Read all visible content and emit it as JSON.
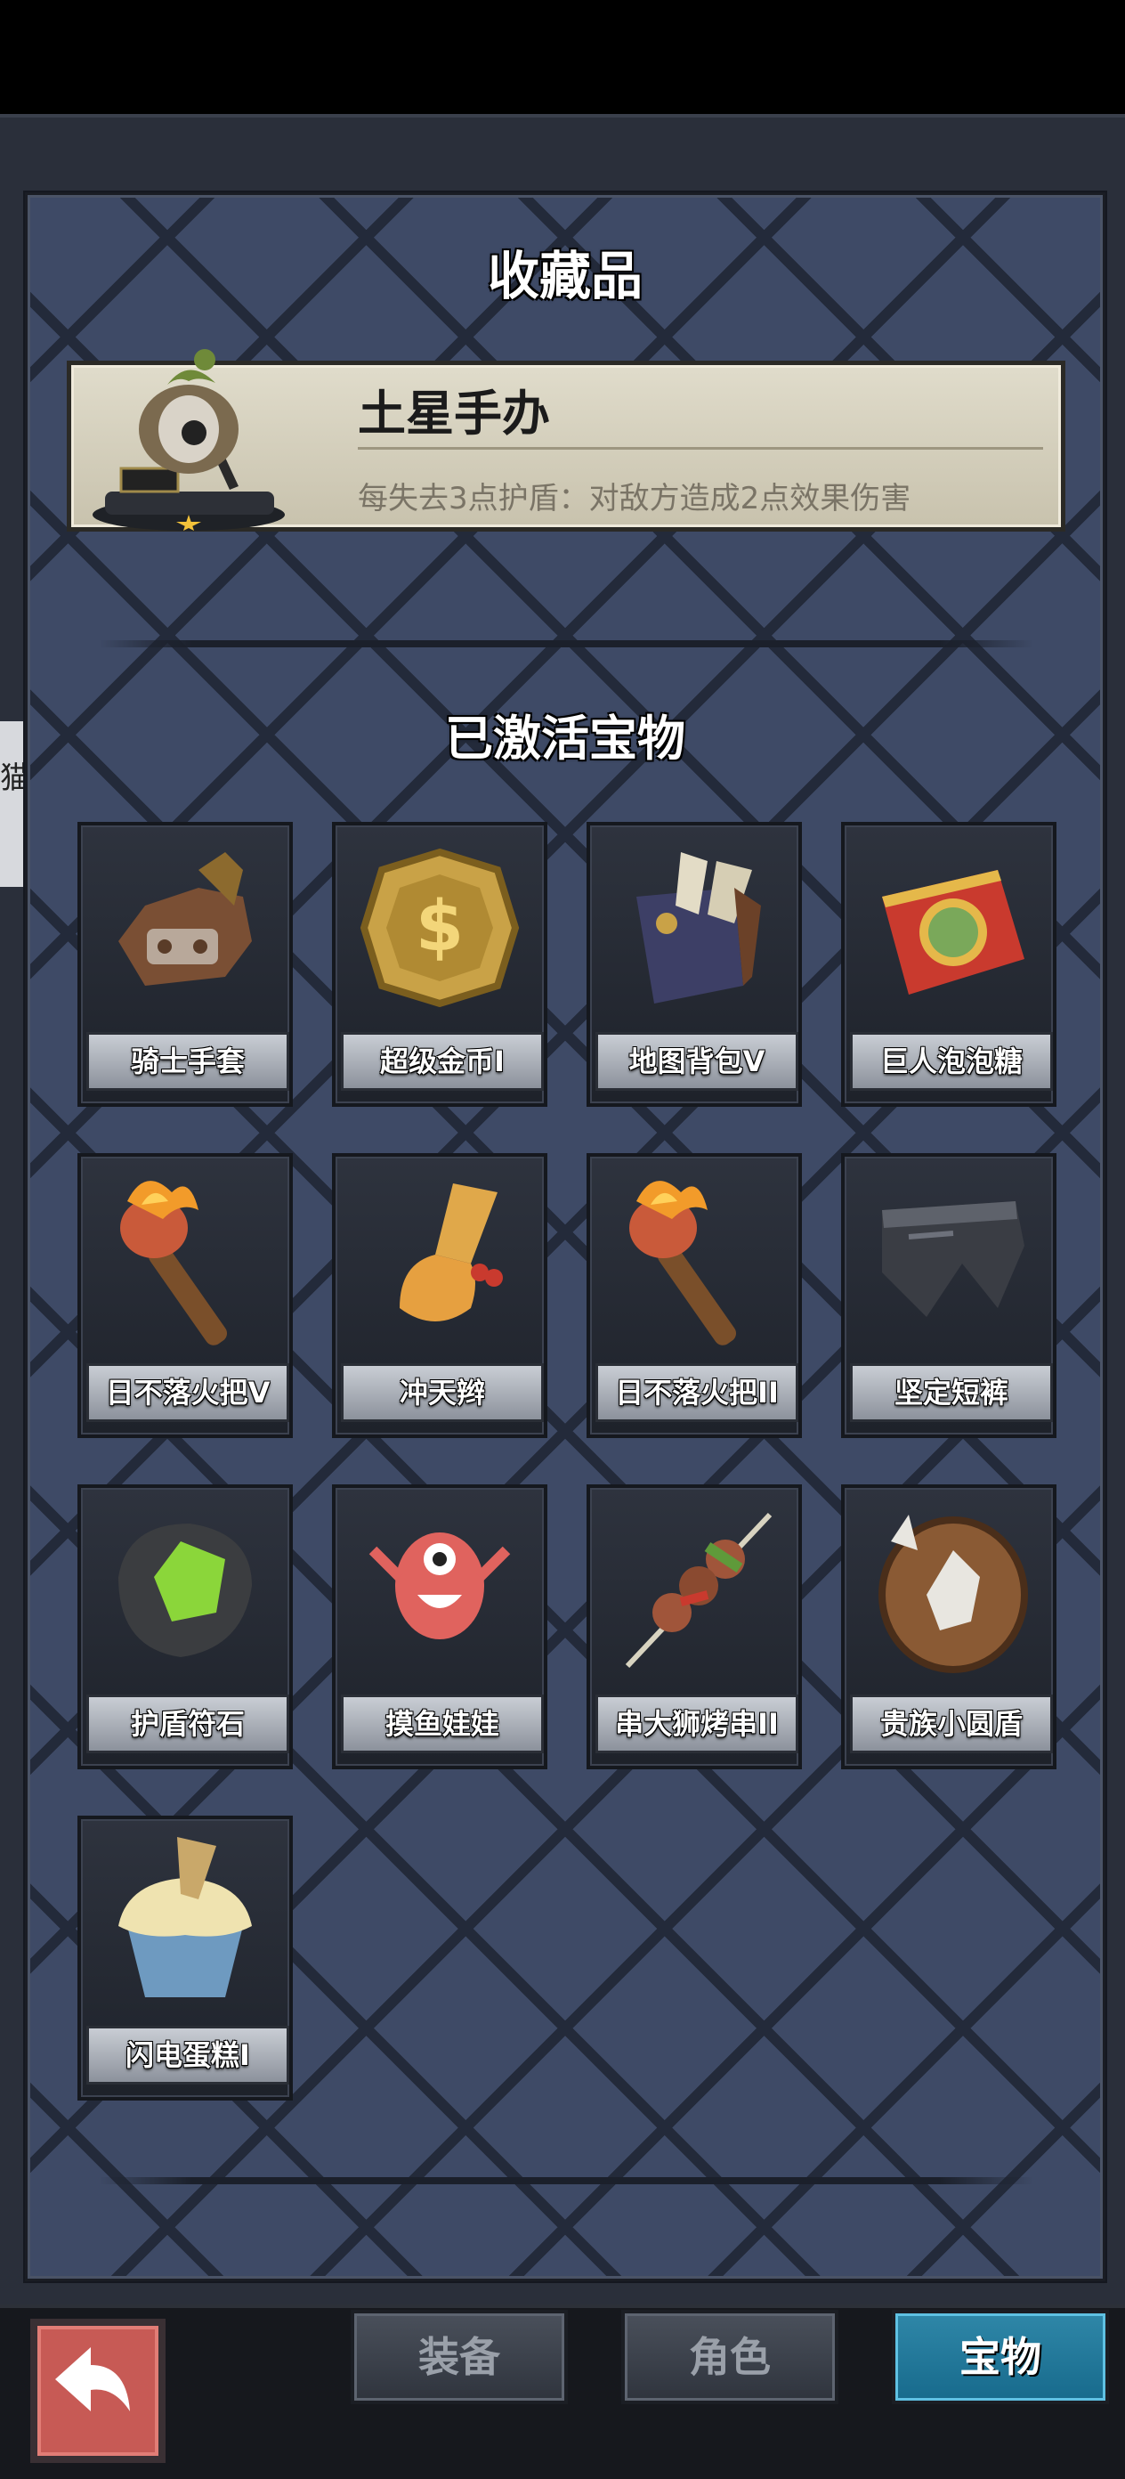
{
  "collection": {
    "title": "收藏品",
    "featured": {
      "name": "土星手办",
      "description": "每失去3点护盾：对敌方造成2点效果伤害",
      "icon": "saturn-figure-icon"
    }
  },
  "activated": {
    "title": "已激活宝物",
    "items": [
      {
        "label": "骑士手套",
        "icon": "knight-gauntlet-icon"
      },
      {
        "label": "超级金币I",
        "icon": "gold-coin-icon"
      },
      {
        "label": "地图背包V",
        "icon": "map-backpack-icon"
      },
      {
        "label": "巨人泡泡糖",
        "icon": "giant-bubblegum-icon"
      },
      {
        "label": "日不落火把V",
        "icon": "torch-icon"
      },
      {
        "label": "冲天辫",
        "icon": "pigtail-icon"
      },
      {
        "label": "日不落火把II",
        "icon": "torch-icon"
      },
      {
        "label": "坚定短裤",
        "icon": "shorts-icon"
      },
      {
        "label": "护盾符石",
        "icon": "shield-rune-icon"
      },
      {
        "label": "摸鱼娃娃",
        "icon": "fish-doll-icon"
      },
      {
        "label": "串大狮烤串II",
        "icon": "skewer-icon"
      },
      {
        "label": "贵族小圆盾",
        "icon": "round-shield-icon"
      },
      {
        "label": "闪电蛋糕I",
        "icon": "lightning-cake-icon"
      }
    ]
  },
  "side_tab": {
    "label": "猫"
  },
  "bottom_nav": {
    "back_icon": "back-arrow-icon",
    "tabs": [
      {
        "label": "装备",
        "active": false
      },
      {
        "label": "角色",
        "active": false
      },
      {
        "label": "宝物",
        "active": true
      }
    ]
  }
}
